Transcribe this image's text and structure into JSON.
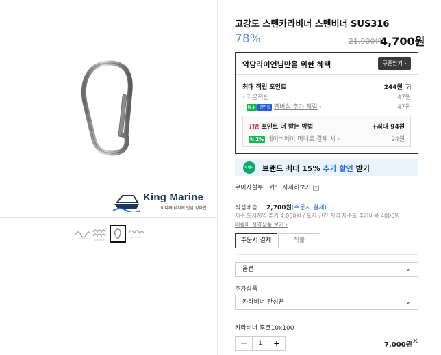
{
  "product": {
    "title": "고강도 스텐카라비너 스텐비너 SUS316",
    "discount": "78%",
    "original_price": "21,900원",
    "price": "4,700원"
  },
  "brand_logo": {
    "name": "King Marine",
    "tagline": "바다와 레저의 만남 킹마린"
  },
  "benefit": {
    "title": "악당라이언님만을 위한 혜택",
    "coupon_button": "쿠폰받기",
    "max_points_label": "최대 적립 포인트",
    "max_points_value": "244원",
    "basic_label": "기본적립",
    "basic_value": "47원",
    "membership_badge_n": "N+",
    "membership_badge_m": "멤버십",
    "membership_label": "멤버십 추가 적립",
    "membership_value": "47원",
    "tip_label": "TIP.",
    "tip_title": "포인트 더 받는 방법",
    "tip_value": "+최대 94원",
    "npay_badge": "N 2%",
    "npay_label": "네이버페이 머니로 결제 시",
    "npay_value": "94원"
  },
  "brand_promo": {
    "badge": "브랜드",
    "text_prefix": "브랜드 최대 15%",
    "text_highlight": "추가 할인",
    "text_suffix": "받기"
  },
  "card_info": {
    "text": "무이자할부 · 카드 자세히보기"
  },
  "shipping": {
    "label": "직접배송",
    "fee": "2,700원",
    "fee_note": "(주문시 결제)",
    "extra": "제주,도서지역 추가 4,000원 / 도서 산간 지역 제주도 추가비용 4000원",
    "saving_link": "배송비 절약상품 보기",
    "option_pay_on_order": "주문시 결제",
    "option_cod": "착불"
  },
  "options": {
    "option_placeholder": "옵션",
    "addon_label": "추가상품",
    "addon_selected": "카라비너 탄성끈",
    "selected_item_name": "카라비너 후크10x100",
    "quantity": "1",
    "minus": "−",
    "plus": "+",
    "line_price": "7,000원"
  },
  "colors": {
    "discount": "#5a8fd6",
    "accent_blue": "#2f6de0",
    "npay_green": "#19b54f"
  }
}
